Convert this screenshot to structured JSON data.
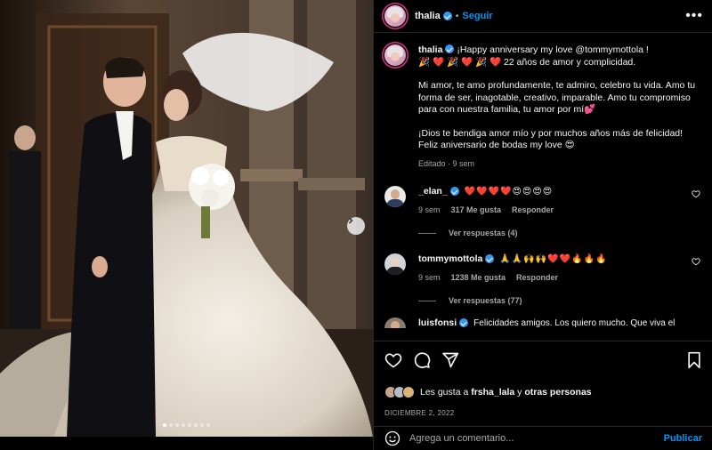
{
  "post": {
    "author": "thalia",
    "follow_label": "Seguir",
    "separator": "•",
    "more_label": "•••",
    "carousel": {
      "total": 8,
      "active": 1
    }
  },
  "caption": {
    "author": "thalia",
    "line1": "¡Happy anniversary my love @tommymottola !",
    "line2": "🎉 ❤️ 🎉 ❤️ 🎉 ❤️ 22 años de amor y complicidad.",
    "para2": "Mi amor, te amo profundamente, te admiro, celebro tu vida. Amo tu forma de ser, inagotable, creativo, imparable. Amo tu compromiso para con nuestra familia, tu amor por mí💕",
    "para3a": "¡Dios te bendiga amor mío y por muchos años más de felicidad!",
    "para3b": "Feliz aniversario de bodas my love 😍",
    "meta": "Editado · 9 sem"
  },
  "comments": [
    {
      "user": "_elan_",
      "text": "❤️❤️❤️❤️😍😍😍😍",
      "time": "9 sem",
      "likes": "317 Me gusta",
      "reply_label": "Responder",
      "replies": "Ver respuestas (4)"
    },
    {
      "user": "tommymottola",
      "text": "🙏🙏🙌🙌❤️❤️🔥🔥🔥",
      "time": "9 sem",
      "likes": "1238 Me gusta",
      "reply_label": "Responder",
      "replies": "Ver respuestas (77)"
    }
  ],
  "partial_comment": {
    "user": "luisfonsi",
    "text": "Felicidades amigos. Los quiero mucho. Que viva el"
  },
  "likes": {
    "prefix": "Les gusta a",
    "user": "frsha_lala",
    "connector": "y",
    "others": "otras personas"
  },
  "date": "DICIEMBRE 2, 2022",
  "composer": {
    "placeholder": "Agrega un comentario...",
    "publish_label": "Publicar"
  },
  "colors": {
    "accent": "#0095f6",
    "verified": "#3797f0",
    "like_red": "#ed4956"
  }
}
